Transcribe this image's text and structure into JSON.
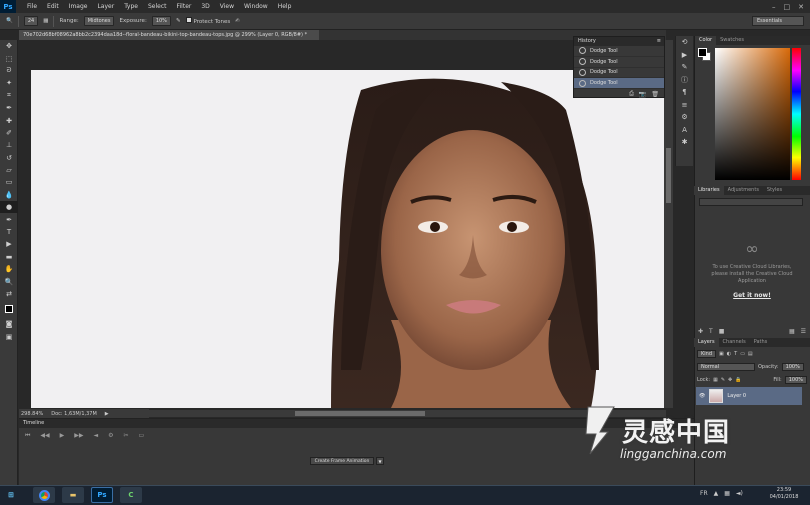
{
  "app": {
    "logo": "Ps"
  },
  "menu": [
    "File",
    "Edit",
    "Image",
    "Layer",
    "Type",
    "Select",
    "Filter",
    "3D",
    "View",
    "Window",
    "Help"
  ],
  "window_buttons": [
    "–",
    "□",
    "✕"
  ],
  "options": {
    "brush_size": "24",
    "range_label": "Range:",
    "range_value": "Midtones",
    "exposure_label": "Exposure:",
    "exposure_value": "10%",
    "protect_tones": "Protect Tones",
    "workspace": "Essentials"
  },
  "document": {
    "tab_title": "70e702d68bf08962a8bb2c2394daa18d--floral-bandeau-bikini-top-bandeau-tops.jpg @ 299% (Layer 0, RGB/8#) *",
    "zoom": "298.84%",
    "doc_size": "Doc: 1,63M/1,37M"
  },
  "history": {
    "title": "History",
    "items": [
      "Dodge Tool",
      "Dodge Tool",
      "Dodge Tool",
      "Dodge Tool"
    ]
  },
  "color_panel": {
    "tabs": [
      "Color",
      "Swatches"
    ]
  },
  "libraries": {
    "tabs": [
      "Libraries",
      "Adjustments",
      "Styles"
    ],
    "message": "To use Creative Cloud Libraries, please install the Creative Cloud Application",
    "link": "Get it now!"
  },
  "layers": {
    "tabs": [
      "Layers",
      "Channels",
      "Paths"
    ],
    "kind": "Kind",
    "blend_mode": "Normal",
    "opacity_label": "Opacity:",
    "opacity": "100%",
    "lock_label": "Lock:",
    "fill_label": "Fill:",
    "fill": "100%",
    "layer_name": "Layer 0"
  },
  "timeline": {
    "title": "Timeline",
    "create_button": "Create Frame Animation"
  },
  "taskbar": {
    "lang": "FR",
    "time": "23:59",
    "date": "04/01/2018"
  },
  "watermark": {
    "brand": "灵感中国",
    "url": "lingganchina.com"
  }
}
